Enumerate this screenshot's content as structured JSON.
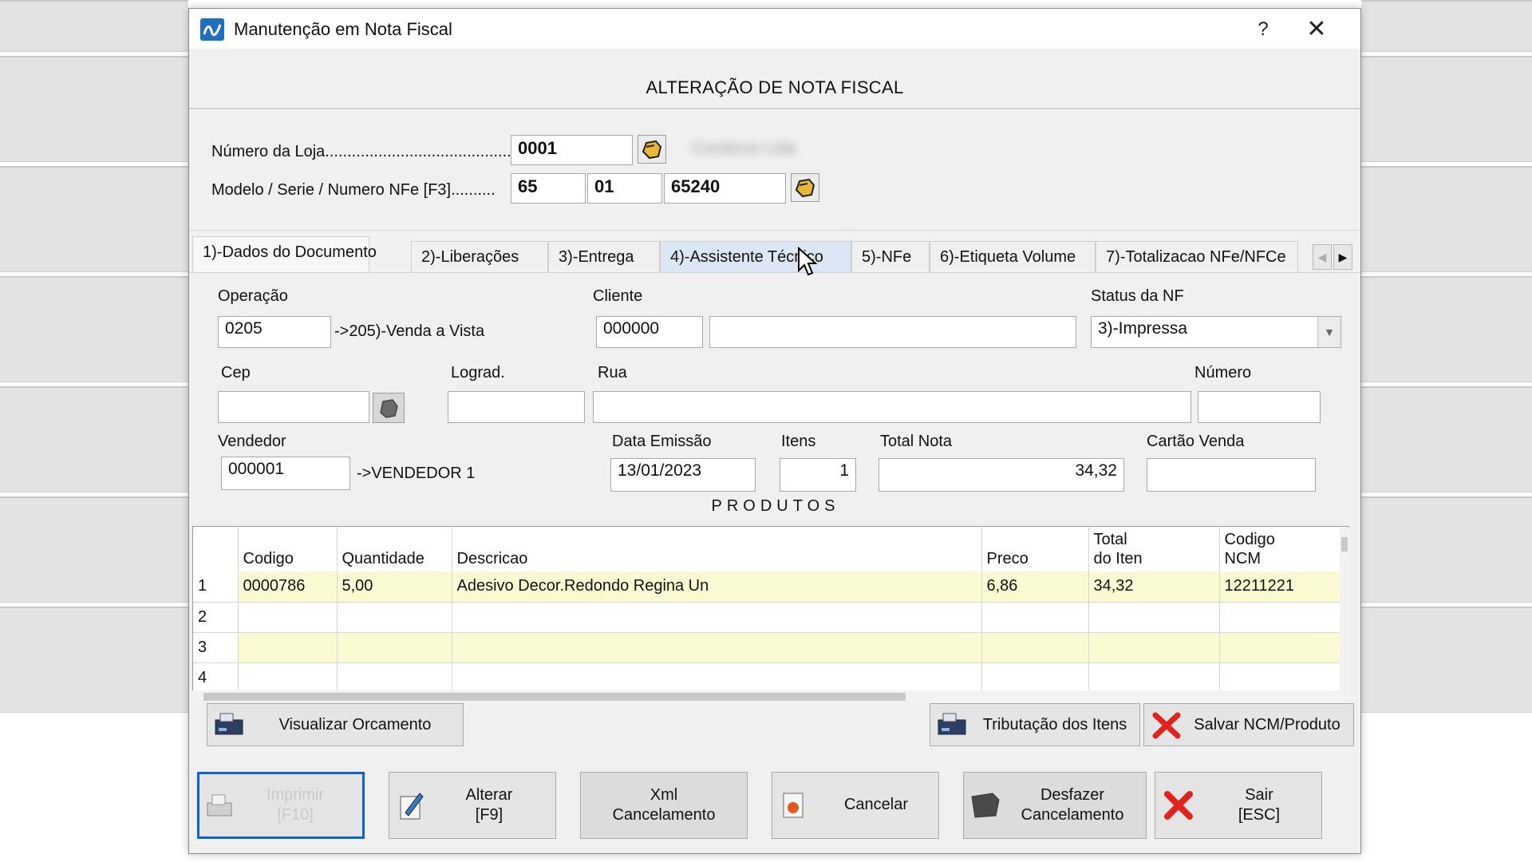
{
  "window": {
    "title": "Manutenção em Nota Fiscal",
    "help_label": "?",
    "close_label": "✕",
    "header": "ALTERAÇÃO DE NOTA FISCAL"
  },
  "top_form": {
    "loja_label": "Número da Loja...........................................",
    "loja_value": "0001",
    "loja_name_blurred": "Comércio Ltda",
    "modelo_label": "Modelo / Serie / Numero NFe [F3]..........",
    "modelo_value": "65",
    "serie_value": "01",
    "numero_value": "65240"
  },
  "tabs": [
    {
      "label": "1)-Dados do Documento"
    },
    {
      "label": "2)-Liberações"
    },
    {
      "label": "3)-Entrega"
    },
    {
      "label": "4)-Assistente Técnico"
    },
    {
      "label": "5)-NFe"
    },
    {
      "label": "6)-Etiqueta Volume"
    },
    {
      "label": "7)-Totalizacao NFe/NFCe"
    }
  ],
  "doc": {
    "operacao_label": "Operação",
    "operacao_value": "0205",
    "operacao_desc": "->205)-Venda a Vista",
    "cliente_label": "Cliente",
    "cliente_value": "000000",
    "cliente_name": "",
    "status_label": "Status da NF",
    "status_value": "3)-Impressa",
    "cep_label": "Cep",
    "cep_value": "",
    "lograd_label": "Lograd.",
    "lograd_value": "",
    "rua_label": "Rua",
    "rua_value": "",
    "numero_label": "Número",
    "numero_value": "",
    "vendedor_label": "Vendedor",
    "vendedor_value": "000001",
    "vendedor_desc": "->VENDEDOR 1",
    "data_label": "Data Emissão",
    "data_value": "13/01/2023",
    "itens_label": "Itens",
    "itens_value": "1",
    "total_label": "Total Nota",
    "total_value": "34,32",
    "cartao_label": "Cartão Venda",
    "cartao_value": ""
  },
  "produtos": {
    "title": "PRODUTOS",
    "columns": [
      "Codigo",
      "Quantidade",
      "Descricao",
      "Preco",
      "Total do Iten",
      "Codigo NCM"
    ],
    "col_total_l1": "Total",
    "col_total_l2": "do Iten",
    "col_ncm_l1": "Codigo",
    "col_ncm_l2": "NCM",
    "rows": [
      {
        "n": "1",
        "codigo": "0000786",
        "quantidade": "5,00",
        "descricao": "Adesivo Decor.Redondo Regina  Un",
        "preco": "6,86",
        "total": "34,32",
        "ncm": "12211221"
      },
      {
        "n": "2",
        "codigo": "",
        "quantidade": "",
        "descricao": "",
        "preco": "",
        "total": "",
        "ncm": ""
      },
      {
        "n": "3",
        "codigo": "",
        "quantidade": "",
        "descricao": "",
        "preco": "",
        "total": "",
        "ncm": ""
      },
      {
        "n": "4",
        "codigo": "",
        "quantidade": "",
        "descricao": "",
        "preco": "",
        "total": "",
        "ncm": ""
      }
    ]
  },
  "mid_buttons": {
    "visualizar": "Visualizar Orcamento",
    "tributacao": "Tributação dos Itens",
    "salvar_ncm": "Salvar NCM/Produto"
  },
  "bottom_buttons": {
    "imprimir_l1": "Imprimir",
    "imprimir_l2": "[F10]",
    "alterar_l1": "Alterar",
    "alterar_l2": "[F9]",
    "xml_l1": "Xml",
    "xml_l2": "Cancelamento",
    "cancelar": "Cancelar",
    "desfazer_l1": "Desfazer",
    "desfazer_l2": "Cancelamento",
    "sair_l1": "Sair",
    "sair_l2": "[ESC]"
  },
  "colors": {
    "accent_focus": "#0a64d8",
    "grid_row_highlight": "#fafad2",
    "tab_hover": "#dce6f4",
    "cancel_x": "#e0231c"
  }
}
